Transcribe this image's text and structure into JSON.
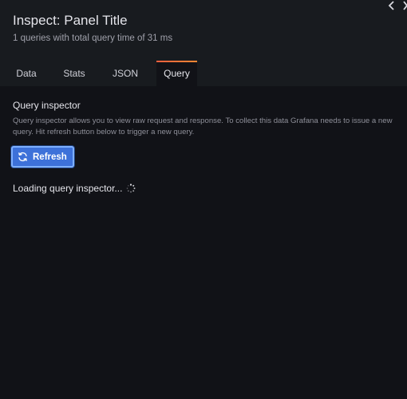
{
  "drawer": {
    "title": "Inspect: Panel Title",
    "subtitle": "1 queries with total query time of 31 ms",
    "header_icons": [
      "chevron-left-icon",
      "close-icon"
    ]
  },
  "tabs": [
    {
      "label": "Data",
      "active": false
    },
    {
      "label": "Stats",
      "active": false
    },
    {
      "label": "JSON",
      "active": false
    },
    {
      "label": "Query",
      "active": true
    }
  ],
  "query_inspector": {
    "title": "Query inspector",
    "description": "Query inspector allows you to view raw request and response. To collect this data Grafana needs to issue a new query. Hit refresh button below to trigger a new query.",
    "refresh_label": "Refresh",
    "loading_text": "Loading query inspector..."
  },
  "colors": {
    "background": "#111217",
    "header_background": "#181b1f",
    "primary_button": "#3d71d9",
    "active_tab_accent": "#f55f3e"
  }
}
